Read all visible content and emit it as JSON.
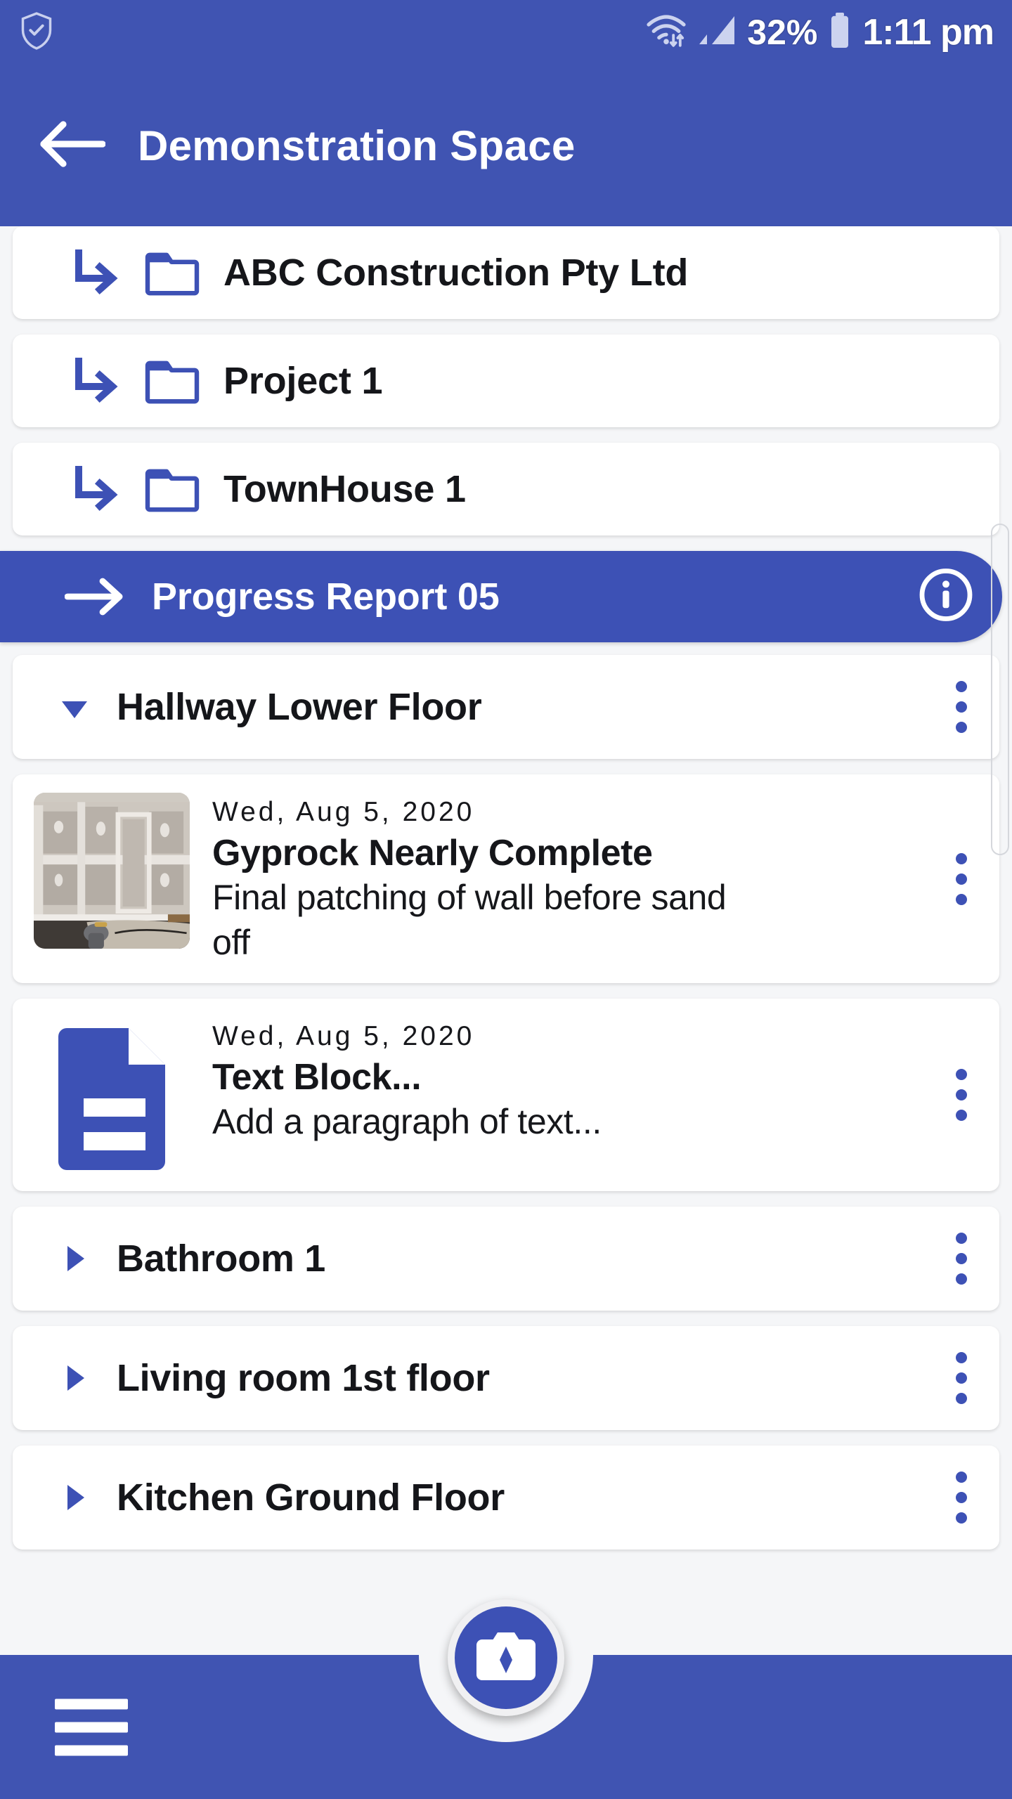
{
  "status_bar": {
    "security_icon": "shield-check-icon",
    "wifi_icon": "wifi-icon",
    "signal_icon": "cellular-signal-icon",
    "battery_percent": "32%",
    "battery_icon": "battery-icon",
    "time": "1:11 pm"
  },
  "app_bar": {
    "back_icon": "back-arrow-icon",
    "title": "Demonstration Space"
  },
  "colors": {
    "primary": "#4054b2",
    "selected": "#3d51b5",
    "accent": "#3d51b5",
    "page_background": "#f5f6f8",
    "card_background": "#ffffff",
    "text": "#15161a",
    "on_primary": "#ffffff"
  },
  "breadcrumbs": [
    {
      "label": "ABC Construction Pty Ltd",
      "icon": "subdirectory-arrow-icon",
      "folder_icon": "folder-icon"
    },
    {
      "label": "Project 1",
      "icon": "subdirectory-arrow-icon",
      "folder_icon": "folder-icon"
    },
    {
      "label": "TownHouse 1",
      "icon": "subdirectory-arrow-icon",
      "folder_icon": "folder-icon"
    }
  ],
  "selected_item": {
    "label": "Progress Report 05",
    "arrow_icon": "right-arrow-icon",
    "info_icon": "info-circle-icon"
  },
  "sections": [
    {
      "label": "Hallway Lower Floor",
      "expanded": true,
      "toggle_icon": "triangle-down-icon",
      "menu_icon": "kebab-menu-icon"
    },
    {
      "label": "Bathroom 1",
      "expanded": false,
      "toggle_icon": "triangle-right-icon",
      "menu_icon": "kebab-menu-icon"
    },
    {
      "label": "Living room 1st floor",
      "expanded": false,
      "toggle_icon": "triangle-right-icon",
      "menu_icon": "kebab-menu-icon"
    },
    {
      "label": "Kitchen Ground Floor",
      "expanded": false,
      "toggle_icon": "triangle-right-icon",
      "menu_icon": "kebab-menu-icon"
    }
  ],
  "entries": [
    {
      "date": "Wed, Aug 5, 2020",
      "title": "Gyprock Nearly Complete",
      "description": "Final patching of wall before sand off",
      "media_type": "photo-thumbnail",
      "menu_icon": "kebab-menu-icon"
    },
    {
      "date": "Wed, Aug 5, 2020",
      "title": "Text Block...",
      "description": "Add a paragraph of text...",
      "media_type": "document-icon",
      "menu_icon": "kebab-menu-icon"
    }
  ],
  "bottom_bar": {
    "menu_icon": "hamburger-menu-icon",
    "camera_fab_icon": "camera-icon"
  },
  "scrollbar": {
    "name": "vertical-scrollbar"
  }
}
